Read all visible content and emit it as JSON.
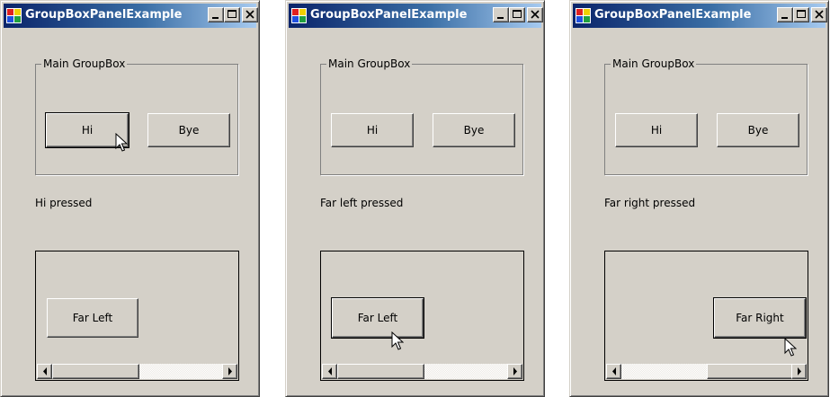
{
  "windows": [
    {
      "title": "GroupBoxPanelExample",
      "group_label": "Main GroupBox",
      "hi_label": "Hi",
      "bye_label": "Bye",
      "status": "Hi pressed",
      "panel_button_label": "Far Left",
      "cursor_on": "Hi"
    },
    {
      "title": "GroupBoxPanelExample",
      "group_label": "Main GroupBox",
      "hi_label": "Hi",
      "bye_label": "Bye",
      "status": "Far left pressed",
      "panel_button_label": "Far Left",
      "cursor_on": "Far Left"
    },
    {
      "title": "GroupBoxPanelExample",
      "group_label": "Main GroupBox",
      "hi_label": "Hi",
      "bye_label": "Bye",
      "status": "Far right pressed",
      "panel_button_label": "Far Right",
      "cursor_on": "Far Right"
    }
  ],
  "colors": {
    "face": "#d4d0c8",
    "title_start": "#0a246a",
    "title_end": "#a6caf0"
  },
  "icons": [
    "app-icon",
    "minimize-icon",
    "maximize-icon",
    "close-icon",
    "scroll-left-arrow-icon",
    "scroll-right-arrow-icon",
    "mouse-pointer-icon"
  ]
}
